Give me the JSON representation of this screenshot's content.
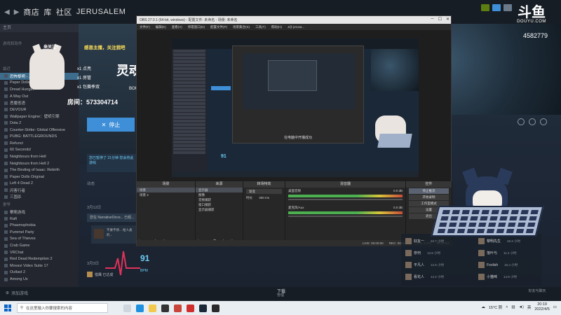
{
  "steam": {
    "nav_back": "◀",
    "nav_fwd": "▶",
    "tabs": [
      "商店",
      "库",
      "社区",
      "JERUSALEM"
    ],
    "sidebar_header": "主页",
    "sidebar_group": "游戏和软件",
    "recent_label": "最近",
    "items": [
      "恐怖黎明 - ...",
      "Paper Dolls...",
      "Dread Hunger",
      "A Way Out",
      "恶魔低语",
      "DEVOUR",
      "Wallpaper Engine：壁纸引擎",
      "Dota 2",
      "Counter-Strike: Global Offensive",
      "PUBG: BATTLEGROUNDS",
      "Refunct",
      "60 Seconds!",
      "Neighbours from Hell",
      "Neighbours from Hell 2",
      "The Binding of Isaac: Rebirth",
      "Paper Dolls Original",
      "Left 4 Dead 2",
      "闪客行者",
      "三国杀",
      "攀爬游戏",
      "Raft",
      "Phasmophobia",
      "Pummel Party",
      "Sea of Thieves",
      "Crab Game",
      "VRChat",
      "Red Dead Redemption 2",
      "Movavi Video Suite 17",
      "Outlast 2",
      "Among Us"
    ],
    "older_label": "更早",
    "play_button": "停止",
    "download_text": "您已暂停了 21分钟\n您会将此游戏",
    "activity_label": "动态",
    "date1": "3月12日",
    "activity_row": "您在 NarrativeOnce... 已经...",
    "activity_card": "不要不停...\n给人类的...",
    "date2": "3月3日",
    "heart_value": "91",
    "heart_unit": "BPM",
    "achievement": "猎鹰 已达成",
    "footer_title": "下载",
    "footer_sub": "管理",
    "add_game": "添加游戏",
    "friends_label": "好友与聊天"
  },
  "banner": {
    "bubble": "来关注~",
    "headline": "感恩主播，关注我吧",
    "lines": [
      "x1  点亮",
      "x1  房管",
      "x1  包赛季双"
    ],
    "big_title": "灵魂",
    "sub_title": "BOULI",
    "room": "房间：573304714"
  },
  "obs": {
    "title": "OBS 27.0.1 (64-bit, windows) - 配置文件: 未命名 - 场景: 未命名",
    "menu": [
      "文件(F)",
      "编辑(E)",
      "查看(V)",
      "停靠窗口(D)",
      "配置文件(P)",
      "场景集合(S)",
      "工具(T)",
      "帮助(H)",
      "J@ jerusa..."
    ],
    "docks": {
      "scenes": {
        "title": "场景",
        "items": [
          "场景",
          "场景 2"
        ]
      },
      "sources": {
        "title": "来源",
        "items": [
          "显示器",
          "图像",
          "音频捕获",
          "窗口捕获",
          "显示器捕获"
        ]
      },
      "transitions": {
        "title": "转场特效",
        "fade": "渐变",
        "duration_label": "时长",
        "duration": "300 ms"
      },
      "mixer": {
        "title": "混音器",
        "ch1": "桌面音频",
        "ch1_db": "0.0 dB",
        "ch2": "麦克风/Aux",
        "ch2_db": "0.0 dB"
      },
      "controls": {
        "title": "控件",
        "buttons": [
          "停止推流",
          "开始录制",
          "工作室模式",
          "设置",
          "退出"
        ]
      }
    },
    "status": [
      "LIVE: 00:00:00",
      "REC: 00:00:00",
      "CPU: 6.1%",
      "60.00 fps"
    ],
    "nested_caption": "在电脑中开播成功"
  },
  "douyu": {
    "logo": "斗鱼",
    "url": "DOUYU.COM",
    "room": "4582779"
  },
  "friends": [
    {
      "name": "好友一",
      "time": "22.7 小时"
    },
    {
      "name": "黎明先生",
      "time": "28.3 小时"
    },
    {
      "name": "奈何",
      "time": "13.8 小时"
    },
    {
      "name": "落叶与",
      "time": "11.2 小时"
    },
    {
      "name": "平凡人",
      "time": "12.5 小时"
    },
    {
      "name": "Foolish",
      "time": "16.4 小时"
    },
    {
      "name": "看花人",
      "time": "14.2 小时"
    },
    {
      "name": "小猫咪",
      "time": "14.9 小时"
    }
  ],
  "taskbar": {
    "search_placeholder": "在这里输入你要搜索的内容",
    "weather": "15°C 阴",
    "time": "20:19",
    "date": "2022/4/5",
    "colors": {
      "win_blue": "#0a64c8",
      "steam_accent": "#3e8fd8",
      "obs_bg": "#272727"
    }
  }
}
